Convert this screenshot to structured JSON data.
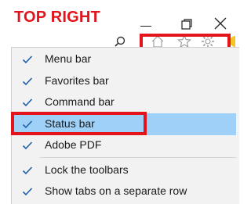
{
  "window": {
    "caption_title": "TOP RIGHT",
    "controls": {
      "minimize": "minimize-icon",
      "restore": "restore-icon",
      "close": "close-icon"
    }
  },
  "toolbar": {
    "icons": [
      "search-icon",
      "home-icon",
      "star-icon",
      "gear-icon",
      "smiley-icon"
    ]
  },
  "context_menu": {
    "items": [
      {
        "label": "Menu bar",
        "checked": true
      },
      {
        "label": "Favorites bar",
        "checked": true
      },
      {
        "label": "Command bar",
        "checked": true
      },
      {
        "label": "Status bar",
        "checked": true,
        "highlighted": true
      },
      {
        "label": "Adobe PDF",
        "checked": true
      },
      {
        "label": "Lock the toolbars",
        "checked": true
      },
      {
        "label": "Show tabs on a separate row",
        "checked": true
      }
    ]
  },
  "colors": {
    "annotation": "#e3141c",
    "highlight": "#9fd0f8",
    "check": "#1f5fa8"
  }
}
